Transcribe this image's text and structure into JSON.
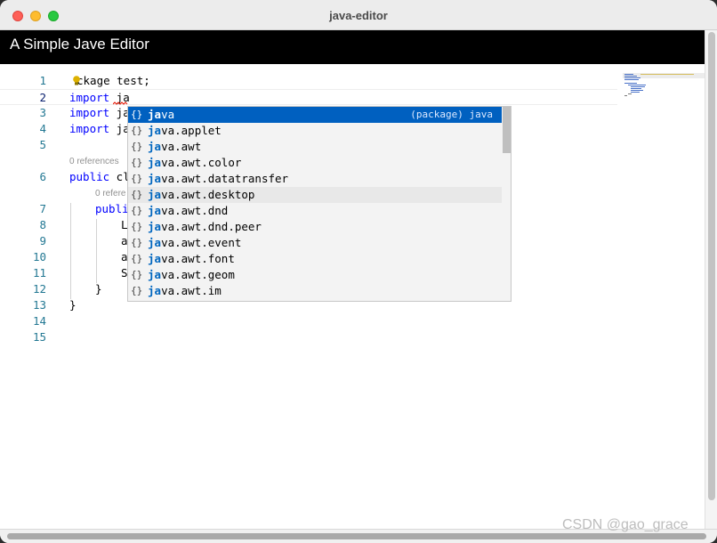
{
  "window": {
    "title": "java-editor"
  },
  "app": {
    "title": "A Simple Jave Editor"
  },
  "editor": {
    "lines": [
      {
        "num": "1",
        "kw": "",
        "rest": "ckage test;"
      },
      {
        "num": "2",
        "kw": "import",
        "rest": " ja"
      },
      {
        "num": "3",
        "kw": "import",
        "rest": " ja"
      },
      {
        "num": "4",
        "kw": "import",
        "rest": " ja"
      },
      {
        "num": "5",
        "kw": "",
        "rest": ""
      },
      {
        "num": "6",
        "kw": "public",
        "rest": " cl"
      },
      {
        "num": "7",
        "kw": "publi",
        "rest": ""
      },
      {
        "num": "8",
        "kw": "",
        "rest": "L"
      },
      {
        "num": "9",
        "kw": "",
        "rest": "a"
      },
      {
        "num": "10",
        "kw": "",
        "rest": "a"
      },
      {
        "num": "11",
        "kw": "",
        "rest": "S"
      },
      {
        "num": "12",
        "kw": "",
        "rest": "}"
      },
      {
        "num": "13",
        "kw": "",
        "rest": "}"
      },
      {
        "num": "14",
        "kw": "",
        "rest": ""
      },
      {
        "num": "15",
        "kw": "",
        "rest": ""
      }
    ],
    "codelens_class": "0 references",
    "codelens_method": "0 refere"
  },
  "suggestions": {
    "typed": "ja",
    "selected_detail": "(package) java",
    "items": [
      {
        "icon": "{}",
        "match": "ja",
        "rest": "va"
      },
      {
        "icon": "{}",
        "match": "ja",
        "rest": "va.applet"
      },
      {
        "icon": "{}",
        "match": "ja",
        "rest": "va.awt"
      },
      {
        "icon": "{}",
        "match": "ja",
        "rest": "va.awt.color"
      },
      {
        "icon": "{}",
        "match": "ja",
        "rest": "va.awt.datatransfer"
      },
      {
        "icon": "{}",
        "match": "ja",
        "rest": "va.awt.desktop"
      },
      {
        "icon": "{}",
        "match": "ja",
        "rest": "va.awt.dnd"
      },
      {
        "icon": "{}",
        "match": "ja",
        "rest": "va.awt.dnd.peer"
      },
      {
        "icon": "{}",
        "match": "ja",
        "rest": "va.awt.event"
      },
      {
        "icon": "{}",
        "match": "ja",
        "rest": "va.awt.font"
      },
      {
        "icon": "{}",
        "match": "ja",
        "rest": "va.awt.geom"
      },
      {
        "icon": "{}",
        "match": "ja",
        "rest": "va.awt.im"
      }
    ]
  },
  "watermark": "CSDN @gao_grace",
  "colors": {
    "keyword": "#0000ff",
    "line_number": "#237893",
    "selection": "#0060c0",
    "match": "#0066bf",
    "header_bg": "#000000"
  },
  "icons": {
    "lightbulb": "lightbulb-icon",
    "module": "module-icon",
    "close": "close-icon",
    "minimize": "minimize-icon",
    "maximize": "maximize-icon"
  }
}
